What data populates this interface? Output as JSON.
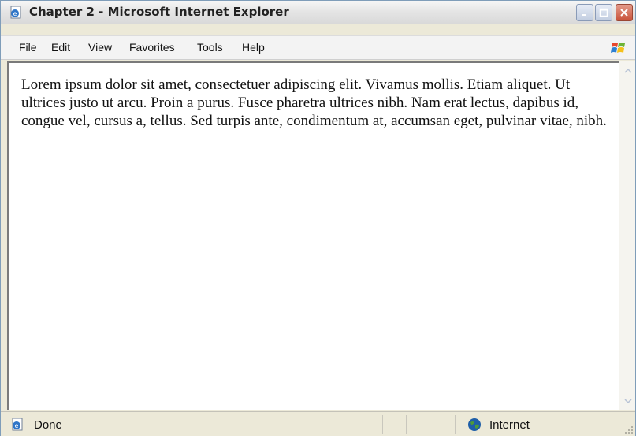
{
  "window": {
    "title": "Chapter 2 - Microsoft Internet Explorer"
  },
  "icons": {
    "app": "ie-page-icon",
    "minimize": "minimize-icon",
    "maximize": "maximize-icon",
    "close": "close-icon",
    "logo": "windows-logo-icon",
    "status": "ie-page-icon",
    "zone": "globe-icon"
  },
  "menu": {
    "items": [
      "File",
      "Edit",
      "View",
      "Favorites",
      "Tools",
      "Help"
    ]
  },
  "content": {
    "text": "Lorem ipsum dolor sit amet, consectetuer adipiscing elit. Vivamus mollis. Etiam aliquet. Ut ultrices justo ut arcu. Proin a purus. Fusce pharetra ultrices nibh. Nam erat lectus, dapibus id, congue vel, cursus a, tellus. Sed turpis ante, condimentum at, accumsan eget, pulvinar vitae, nibh."
  },
  "status": {
    "text": "Done",
    "zone": "Internet"
  },
  "colors": {
    "window_border": "#7f9db9",
    "close_button": "#c9523a",
    "status_bg": "#ece9d8"
  }
}
